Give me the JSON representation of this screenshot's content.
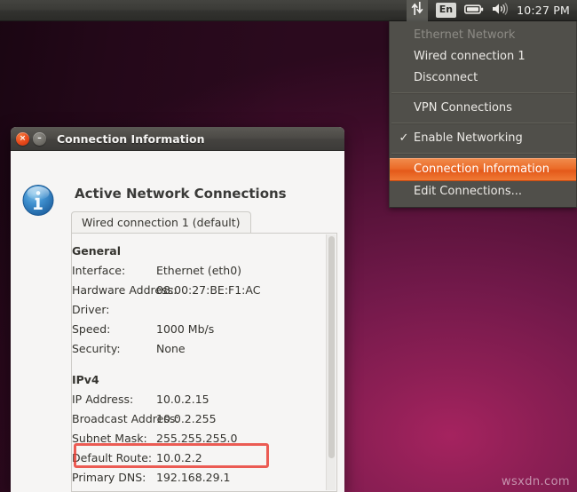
{
  "panel": {
    "network_icon": "network-up-down-arrows-icon",
    "keyboard_layout": "En",
    "battery_icon": "battery-icon",
    "volume_icon": "volume-icon",
    "clock": "10:27 PM"
  },
  "network_menu": {
    "items": [
      {
        "label": "Ethernet Network",
        "state": "disabled",
        "checked": false
      },
      {
        "label": "Wired connection 1",
        "state": "normal",
        "checked": false
      },
      {
        "label": "Disconnect",
        "state": "normal",
        "checked": false
      },
      {
        "label": "VPN Connections",
        "state": "normal",
        "checked": false
      },
      {
        "label": "Enable Networking",
        "state": "normal",
        "checked": true
      },
      {
        "label": "Connection Information",
        "state": "selected",
        "checked": false
      },
      {
        "label": "Edit Connections...",
        "state": "normal",
        "checked": false
      }
    ],
    "selected_color": "#e4591a"
  },
  "dialog": {
    "title": "Connection Information",
    "close_label": "×",
    "minimize_label": "–",
    "heading": "Active Network Connections",
    "info_icon": "info-icon",
    "tab_label": "Wired connection 1 (default)",
    "sections": [
      {
        "title": "General",
        "rows": [
          {
            "key": "Interface:",
            "value": "Ethernet (eth0)"
          },
          {
            "key": "Hardware Address:",
            "value": "08:00:27:BE:F1:AC"
          },
          {
            "key": "Driver:",
            "value": ""
          },
          {
            "key": "Speed:",
            "value": "1000 Mb/s"
          },
          {
            "key": "Security:",
            "value": "None"
          }
        ]
      },
      {
        "title": "IPv4",
        "rows": [
          {
            "key": "IP Address:",
            "value": "10.0.2.15"
          },
          {
            "key": "Broadcast Address:",
            "value": "10.0.2.255"
          },
          {
            "key": "Subnet Mask:",
            "value": "255.255.255.0"
          },
          {
            "key": "Default Route:",
            "value": "10.0.2.2"
          },
          {
            "key": "Primary DNS:",
            "value": "192.168.29.1"
          }
        ]
      }
    ],
    "highlight": {
      "target": "Default Route:",
      "color": "#e8392f"
    }
  },
  "desktop": {
    "watermark": "wsxdn.com"
  }
}
